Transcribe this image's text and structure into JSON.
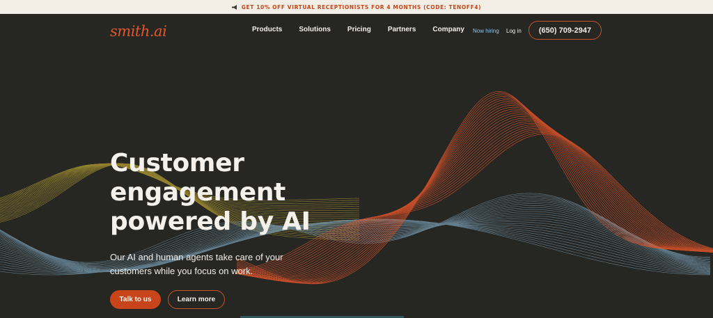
{
  "promo": {
    "icon": "megaphone-icon",
    "text": "GET 10% OFF VIRTUAL RECEPTIONISTS FOR 4 MONTHS (CODE: TENOFF4)"
  },
  "nav": {
    "logo": "smith.ai",
    "menu": [
      "Products",
      "Solutions",
      "Pricing",
      "Partners",
      "Company"
    ],
    "hiring": "Now hiring",
    "login": "Log in",
    "phone": "(650) 709-2947"
  },
  "hero": {
    "title_lines": [
      "Customer",
      "engagement",
      "powered by AI"
    ],
    "subtitle_lines": [
      "Our AI and  human agents take care of your",
      "customers while you focus on work."
    ],
    "primary_button": "Talk to us",
    "secondary_button": "Learn more"
  },
  "colors": {
    "background": "#262623",
    "accent": "#c8451c",
    "banner": "#f3efe6",
    "wave_orange": "#e0552a",
    "wave_blue": "#7fa6be",
    "wave_yellow": "#b9a233"
  }
}
